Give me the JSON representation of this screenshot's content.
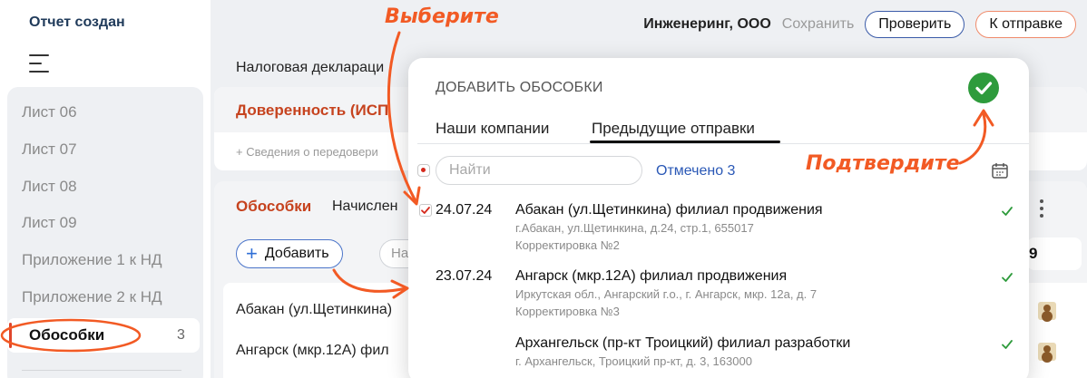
{
  "sidebar": {
    "report_status": "Отчет создан",
    "items": [
      {
        "label": "Лист 06"
      },
      {
        "label": "Лист 07"
      },
      {
        "label": "Лист 08"
      },
      {
        "label": "Лист 09"
      },
      {
        "label": "Приложение 1 к НД"
      },
      {
        "label": "Приложение 2 к НД"
      },
      {
        "label": "Обособки",
        "count": "3",
        "active": true
      }
    ]
  },
  "header": {
    "org_name": "Инженеринг, ООО",
    "save_label": "Сохранить",
    "check_label": "Проверить",
    "send_label": "К отправке"
  },
  "main": {
    "doc_title": "Налоговая деклараци",
    "trust_title": "Доверенность (ИСП",
    "trust_sub": "+ Сведения о передовери",
    "subdivisions_title": "Обособки",
    "charged_label": "Начислен",
    "add_label": "Добавить",
    "ghost_label": "На",
    "count_value": "9",
    "rows": [
      {
        "label": "Абакан (ул.Щетинкина)"
      },
      {
        "label": "Ангарск (мкр.12А) фил"
      }
    ]
  },
  "popup": {
    "title": "ДОБАВИТЬ ОБОСОБКИ",
    "tabs": [
      {
        "label": "Наши компании",
        "active": false
      },
      {
        "label": "Предыдущие отправки",
        "active": true
      }
    ],
    "search_placeholder": "Найти",
    "marked_label": "Отмечено 3",
    "entries": [
      {
        "date": "24.07.24",
        "name": "Абакан (ул.Щетинкина) филиал продвижения",
        "address": "г.Абакан, ул.Щетинкина, д.24, стр.1, 655017",
        "correction": "Корректировка №2",
        "checked": true
      },
      {
        "date": "23.07.24",
        "name": "Ангарск (мкр.12А) филиал продвижения",
        "address": "Иркутская обл., Ангарский г.о., г. Ангарск, мкр. 12а, д. 7",
        "correction": "Корректировка №3",
        "checked": false
      },
      {
        "date": "",
        "name": "Архангельск (пр-кт Троицкий) филиал разработки",
        "address": "г. Архангельск, Троицкий пр-кт, д. 3, 163000",
        "correction": "",
        "checked": false
      }
    ]
  },
  "annotations": {
    "select": "Выберите",
    "confirm": "Подтвердите"
  },
  "colors": {
    "accent_red": "#c6431f",
    "annotation_orange": "#f25a24",
    "confirm_green": "#2e9b3c",
    "link_blue": "#2a58b6"
  },
  "icons": [
    "hamburger-icon",
    "plus-icon",
    "checkmark-icon",
    "calendar-icon",
    "more-vertical-icon",
    "avatar-icon"
  ]
}
